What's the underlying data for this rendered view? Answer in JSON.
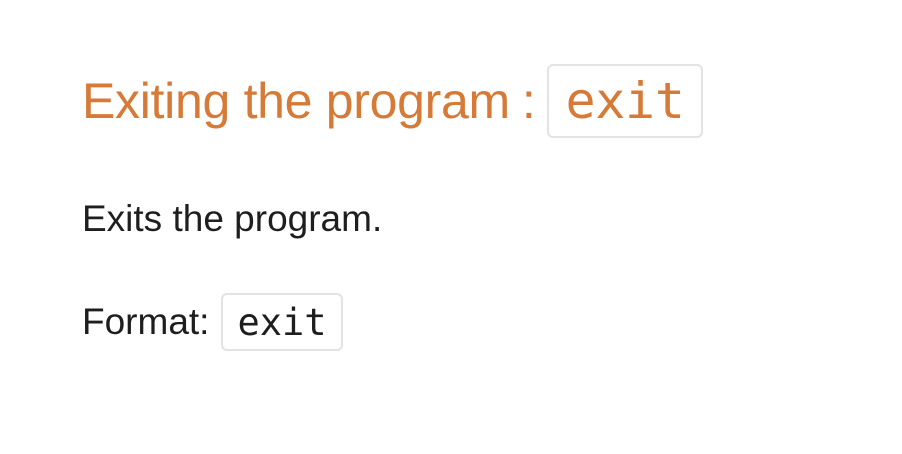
{
  "section": {
    "title_text": "Exiting the program",
    "title_separator": ":",
    "title_code": "exit",
    "description": "Exits the program.",
    "format_label": "Format:",
    "format_code": "exit"
  },
  "colors": {
    "heading": "#d67a37",
    "body_text": "#1e1e1e",
    "code_border": "#e3e3e3",
    "background": "#ffffff"
  }
}
